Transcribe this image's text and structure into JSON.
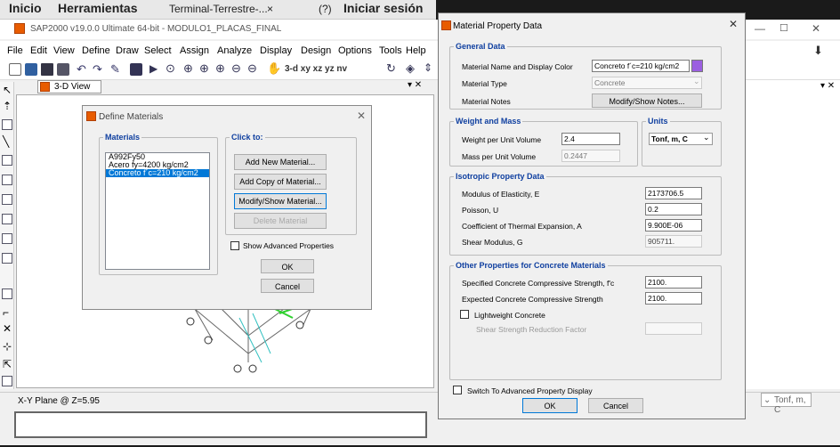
{
  "browser": {
    "home": "Inicio",
    "tools": "Herramientas",
    "tab": "Terminal-Terrestre-...",
    "tab_close": "×",
    "help": "(?)",
    "login": "Iniciar sesión"
  },
  "app": {
    "title": "SAP2000 v19.0.0 Ultimate 64-bit - MODULO1_PLACAS_FINAL",
    "menus": [
      "File",
      "Edit",
      "View",
      "Define",
      "Draw",
      "Select",
      "Assign",
      "Analyze",
      "Display",
      "Design",
      "Options",
      "Tools",
      "Help"
    ],
    "toolbar_text": "3-d  xy  xz  yz  nv",
    "view_tab": "3-D View",
    "status": "X-Y Plane @ Z=5.95",
    "units_status": "Tonf, m, C"
  },
  "define_materials": {
    "title": "Define Materials",
    "materials_legend": "Materials",
    "materials": [
      "A992Fy50",
      "Acero fy=4200 kg/cm2",
      "Concreto f´c=210 kg/cm2"
    ],
    "selected_index": 2,
    "click_to_legend": "Click to:",
    "add_new": "Add New Material...",
    "add_copy": "Add Copy of Material...",
    "modify_show": "Modify/Show Material...",
    "delete": "Delete Material",
    "show_advanced": "Show Advanced Properties",
    "ok": "OK",
    "cancel": "Cancel"
  },
  "material_property": {
    "title": "Material Property Data",
    "general_legend": "General Data",
    "name_label": "Material Name and Display Color",
    "name_value": "Concreto f´c=210 kg/cm2",
    "display_color": "#9b5fe0",
    "type_label": "Material Type",
    "type_value": "Concrete",
    "notes_label": "Material Notes",
    "notes_button": "Modify/Show Notes...",
    "weight_legend": "Weight and Mass",
    "weight_label": "Weight per Unit Volume",
    "weight_value": "2.4",
    "mass_label": "Mass per Unit Volume",
    "mass_value": "0.2447",
    "units_legend": "Units",
    "units_value": "Tonf, m, C",
    "iso_legend": "Isotropic Property Data",
    "elasticity_label": "Modulus of Elasticity,  E",
    "elasticity_value": "2173706.5",
    "poisson_label": "Poisson,  U",
    "poisson_value": "0.2",
    "thermal_label": "Coefficient of Thermal Expansion,  A",
    "thermal_value": "9.900E-06",
    "shear_label": "Shear Modulus,  G",
    "shear_value": "905711.",
    "concrete_legend": "Other Properties for Concrete Materials",
    "fc_label": "Specified Concrete Compressive Strength, f'c",
    "fc_value": "2100.",
    "expected_label": "Expected Concrete Compressive Strength",
    "expected_value": "2100.",
    "lightweight_label": "Lightweight Concrete",
    "shear_reduction_label": "Shear Strength Reduction Factor",
    "switch_label": "Switch To Advanced Property Display",
    "ok": "OK",
    "cancel": "Cancel"
  }
}
